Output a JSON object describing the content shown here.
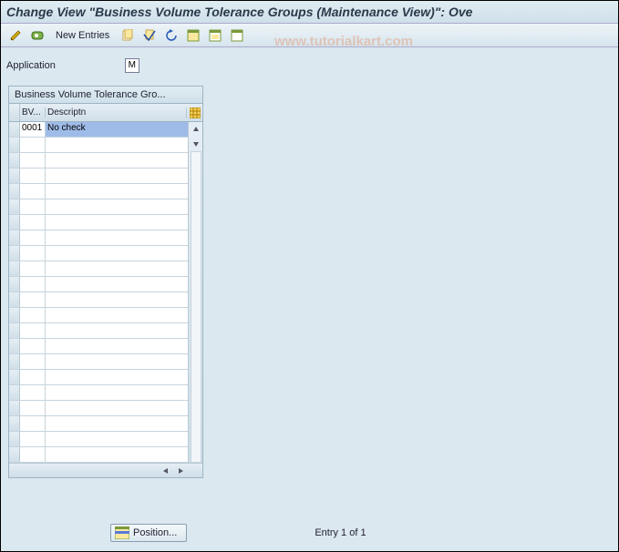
{
  "title": "Change View \"Business Volume Tolerance Groups (Maintenance View)\": Ove",
  "watermark": "www.tutorialkart.com",
  "toolbar": {
    "new_entries": "New Entries"
  },
  "application": {
    "label": "Application",
    "value": "M"
  },
  "grid": {
    "title": "Business Volume Tolerance Gro...",
    "columns": {
      "bv": "BV...",
      "desc": "Descriptn"
    },
    "rows": [
      {
        "bv": "0001",
        "desc": "No check",
        "selected": true
      },
      {
        "bv": "",
        "desc": ""
      },
      {
        "bv": "",
        "desc": ""
      },
      {
        "bv": "",
        "desc": ""
      },
      {
        "bv": "",
        "desc": ""
      },
      {
        "bv": "",
        "desc": ""
      },
      {
        "bv": "",
        "desc": ""
      },
      {
        "bv": "",
        "desc": ""
      },
      {
        "bv": "",
        "desc": ""
      },
      {
        "bv": "",
        "desc": ""
      },
      {
        "bv": "",
        "desc": ""
      },
      {
        "bv": "",
        "desc": ""
      },
      {
        "bv": "",
        "desc": ""
      },
      {
        "bv": "",
        "desc": ""
      },
      {
        "bv": "",
        "desc": ""
      },
      {
        "bv": "",
        "desc": ""
      },
      {
        "bv": "",
        "desc": ""
      },
      {
        "bv": "",
        "desc": ""
      },
      {
        "bv": "",
        "desc": ""
      },
      {
        "bv": "",
        "desc": ""
      },
      {
        "bv": "",
        "desc": ""
      },
      {
        "bv": "",
        "desc": ""
      }
    ]
  },
  "footer": {
    "position": "Position...",
    "entry": "Entry 1 of 1"
  }
}
